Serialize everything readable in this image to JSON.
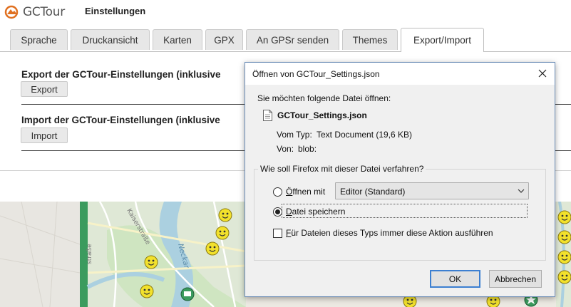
{
  "header": {
    "logo_text": "GCTour",
    "page_title": "Einstellungen"
  },
  "tabs": [
    {
      "label": "Sprache",
      "active": false
    },
    {
      "label": "Druckansicht",
      "active": false
    },
    {
      "label": "Karten",
      "active": false
    },
    {
      "label": "GPX",
      "active": false
    },
    {
      "label": "An GPSr senden",
      "active": false
    },
    {
      "label": "Themes",
      "active": false
    },
    {
      "label": "Export/Import",
      "active": true
    }
  ],
  "content": {
    "export_title": "Export der GCTour-Einstellungen (inklusive",
    "export_button": "Export",
    "import_title": "Import der GCTour-Einstellungen (inklusive",
    "import_button": "Import"
  },
  "dialog": {
    "title": "Öffnen von GCTour_Settings.json",
    "prompt": "Sie möchten folgende Datei öffnen:",
    "file_name": "GCTour_Settings.json",
    "type_label": "Vom Typ:",
    "type_value": "Text Document (19,6 KB)",
    "from_label": "Von:",
    "from_value": "blob:",
    "question": "Wie soll Firefox mit dieser Datei verfahren?",
    "open_with_key": "Ö",
    "open_with_rest": "ffnen mit",
    "open_with_app": "Editor (Standard)",
    "save_key": "D",
    "save_rest": "atei speichern",
    "always_key": "F",
    "always_rest": "ür Dateien dieses Typs immer diese Aktion ausführen",
    "ok": "OK",
    "cancel": "Abbrechen",
    "selected_option": "save",
    "always_checked": false
  },
  "colors": {
    "accent": "#3c7fd1",
    "logo_orange": "#e07020",
    "map_river": "#abd0e0",
    "map_park": "#cfe5c1",
    "map_strip": "#3b9b5e",
    "smiley": "#f2e12c"
  },
  "map": {
    "street_labels": [
      "Neckar",
      "straße",
      "Kaiserstraße"
    ]
  }
}
